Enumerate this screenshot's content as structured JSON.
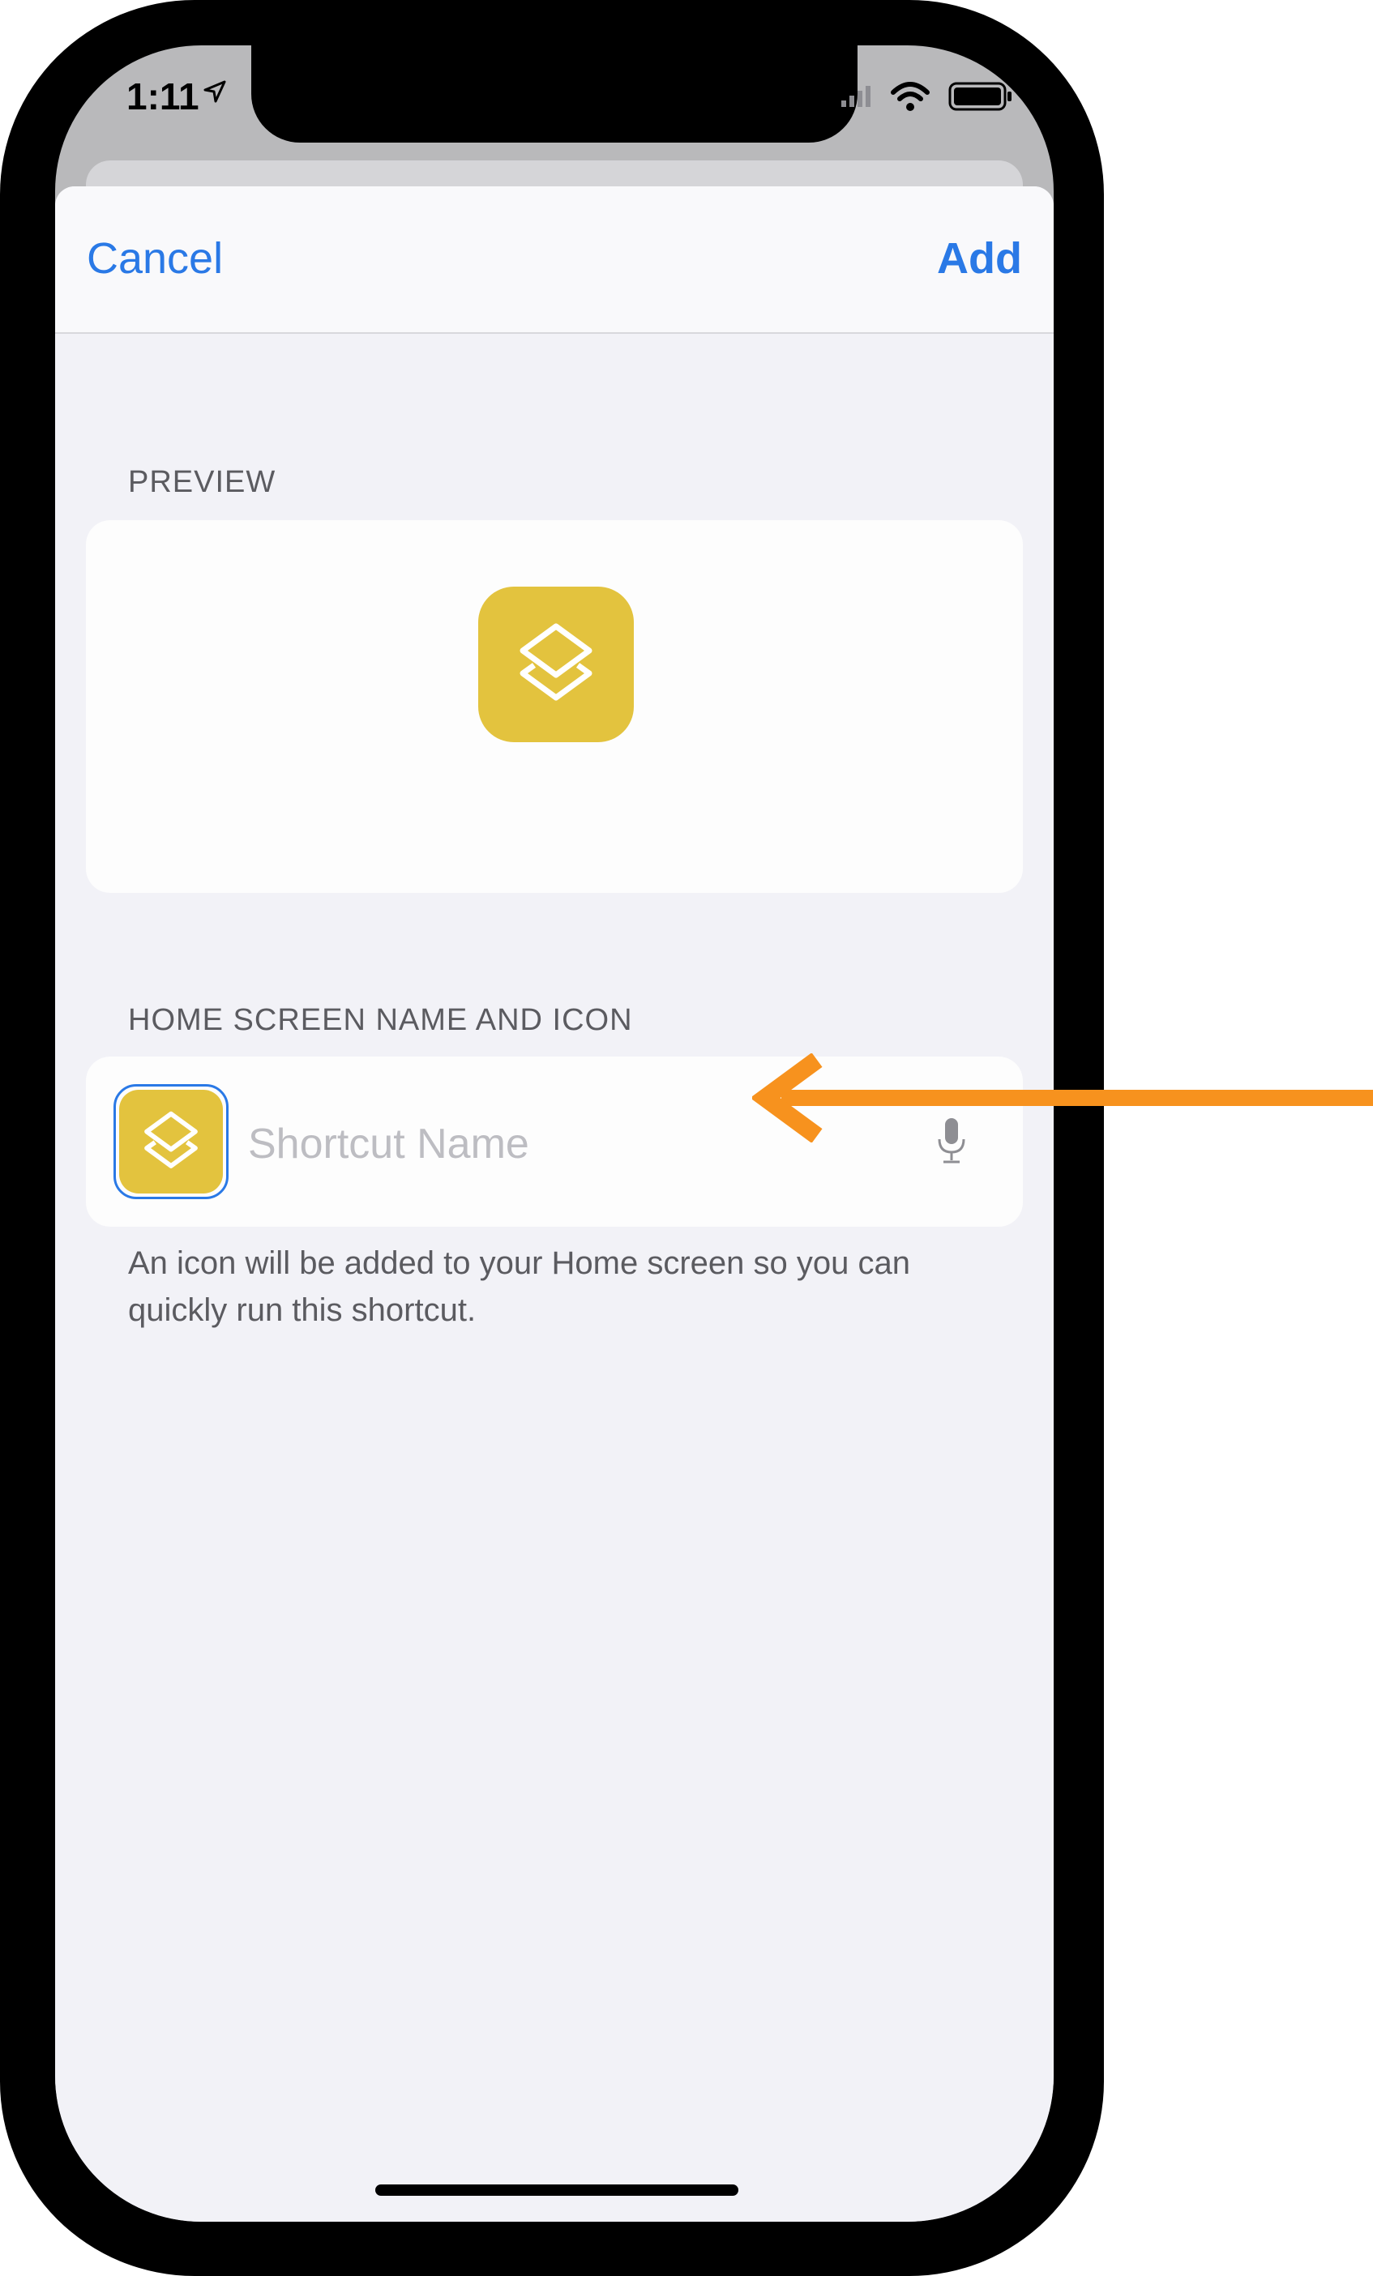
{
  "status_bar": {
    "time": "1:11"
  },
  "nav": {
    "cancel_label": "Cancel",
    "add_label": "Add"
  },
  "preview": {
    "section_label": "PREVIEW"
  },
  "home_screen": {
    "section_label": "HOME SCREEN NAME AND ICON",
    "name_placeholder": "Shortcut Name",
    "name_value": "",
    "footer_note": "An icon will be added to your Home screen so you can quickly run this shortcut."
  },
  "icons": {
    "shortcut_icon": "shortcuts-layers-icon",
    "mic": "microphone-icon",
    "location": "location-arrow-icon",
    "wifi": "wifi-icon",
    "battery": "battery-icon",
    "signal": "cellular-signal-icon",
    "annotation": "orange-arrow-icon"
  },
  "colors": {
    "accent": "#2a79e6",
    "shortcut_icon_bg": "#e3c33e",
    "annotation_arrow": "#f7921e"
  }
}
